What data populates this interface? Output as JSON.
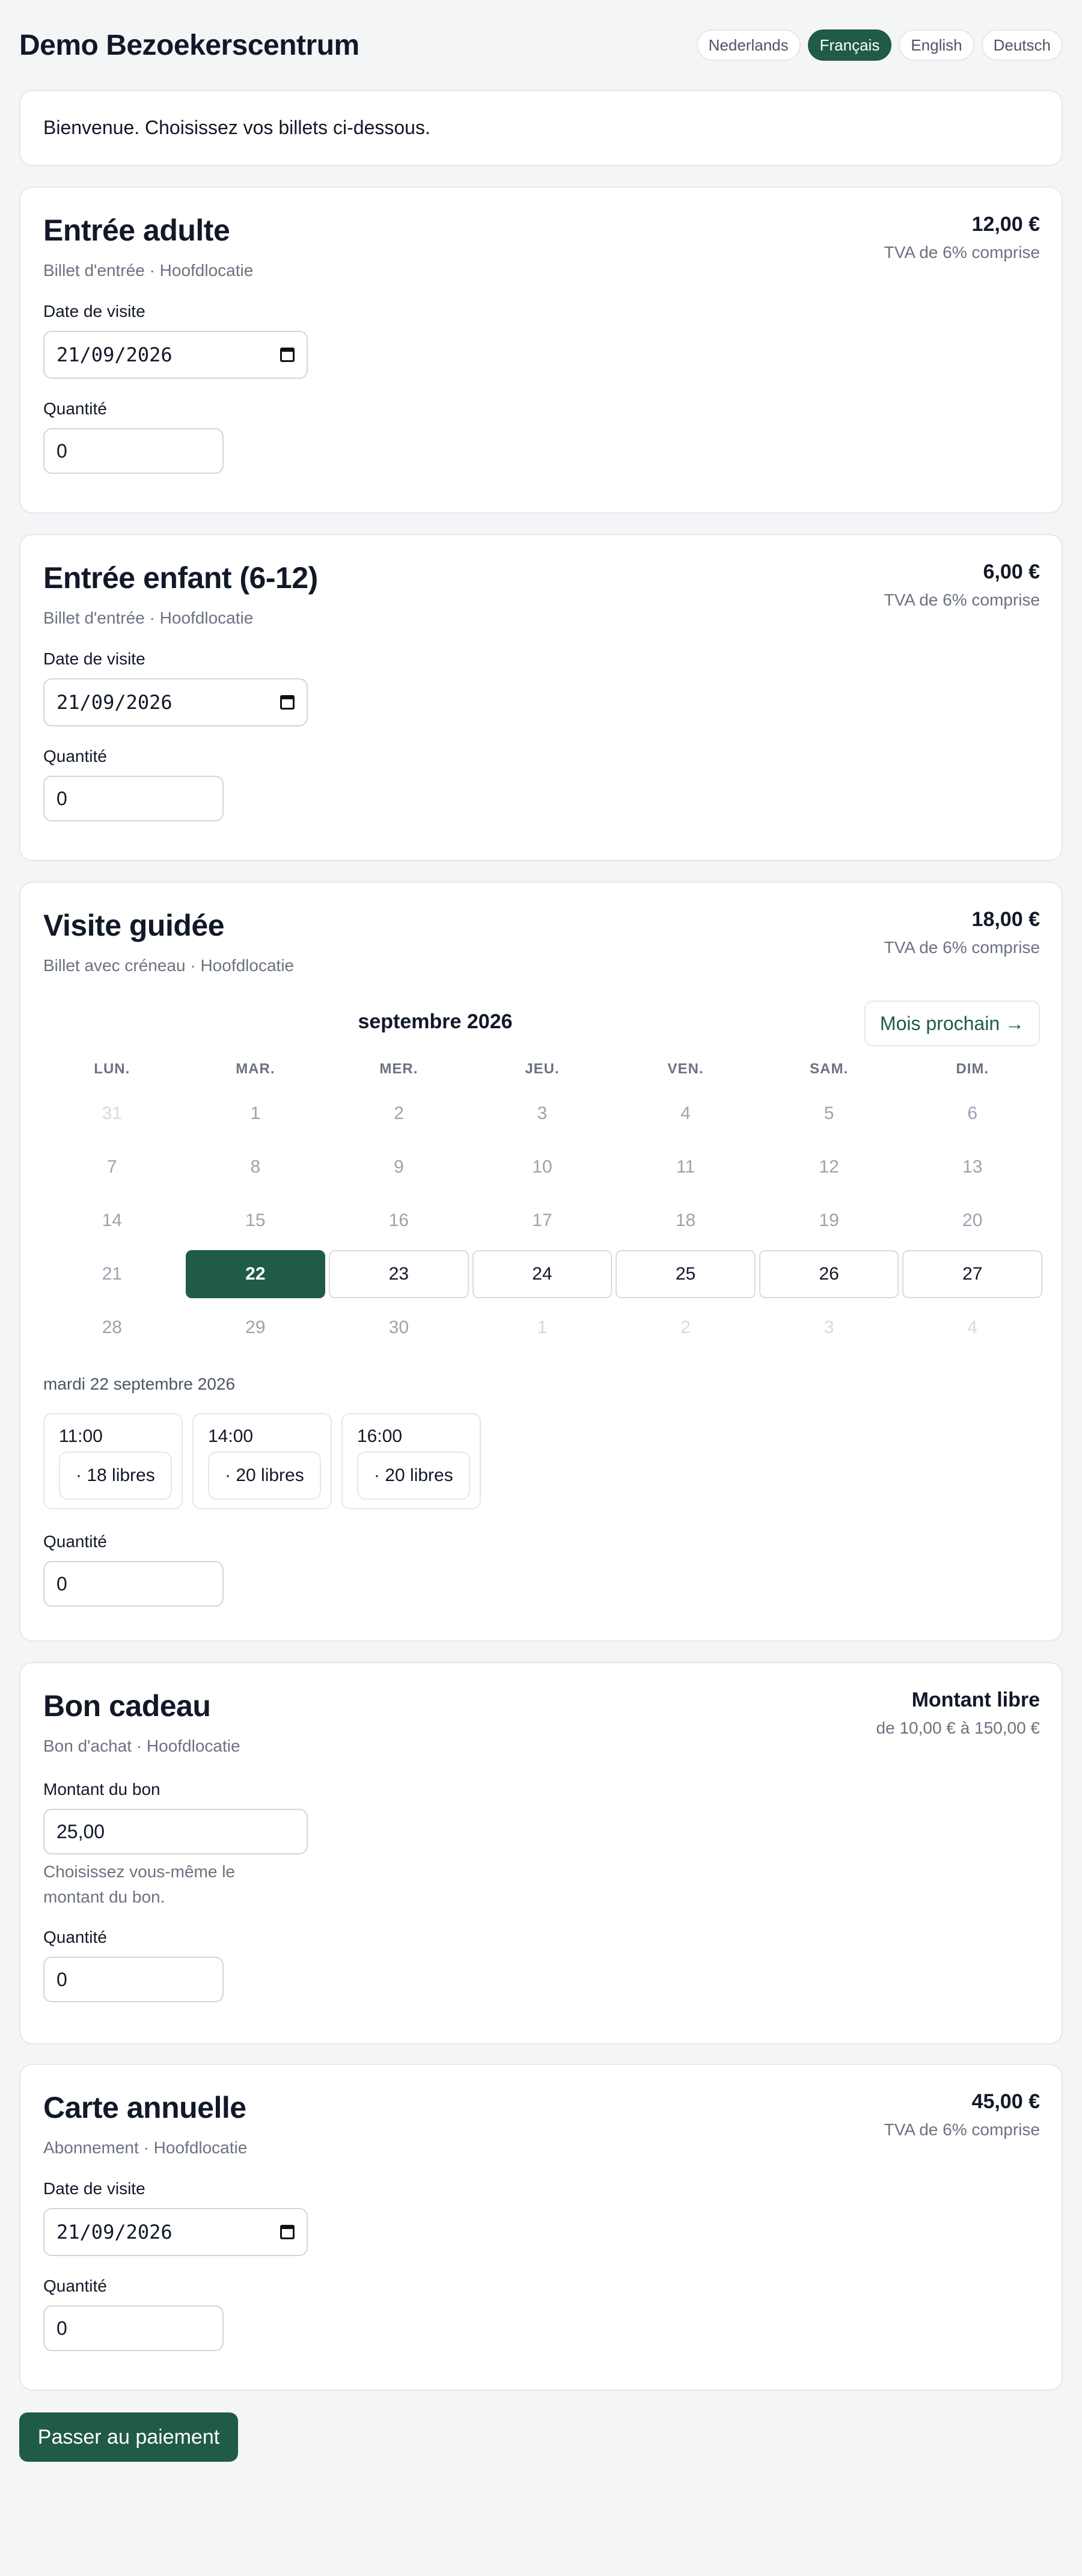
{
  "site": {
    "title": "Demo Bezoekerscentrum"
  },
  "languages": [
    {
      "label": "Nederlands",
      "active": false
    },
    {
      "label": "Français",
      "active": true
    },
    {
      "label": "English",
      "active": false
    },
    {
      "label": "Deutsch",
      "active": false
    }
  ],
  "welcome": "Bienvenue. Choisissez vos billets ci-dessous.",
  "labels": {
    "visit_date": "Date de visite",
    "quantity": "Quantité",
    "voucher_amount": "Montant du bon",
    "voucher_help": "Choisissez vous-même le montant du bon."
  },
  "products": {
    "adult": {
      "title": "Entrée adulte",
      "subtitle": "Billet d'entrée · Hoofdlocatie",
      "price": "12,00 €",
      "vat": "TVA de 6% comprise",
      "date": "21/09/2026",
      "quantity": "0"
    },
    "child": {
      "title": "Entrée enfant (6-12)",
      "subtitle": "Billet d'entrée · Hoofdlocatie",
      "price": "6,00 €",
      "vat": "TVA de 6% comprise",
      "date": "21/09/2026",
      "quantity": "0"
    },
    "guided": {
      "title": "Visite guidée",
      "subtitle": "Billet avec créneau · Hoofdlocatie",
      "price": "18,00 €",
      "vat": "TVA de 6% comprise",
      "calendar": {
        "month": "septembre 2026",
        "next_button": "Mois prochain →",
        "weekdays": [
          "LUN.",
          "MAR.",
          "MER.",
          "JEU.",
          "VEN.",
          "SAM.",
          "DIM."
        ],
        "weeks": [
          [
            {
              "d": "31",
              "s": "out"
            },
            {
              "d": "1",
              "s": "past"
            },
            {
              "d": "2",
              "s": "past"
            },
            {
              "d": "3",
              "s": "past"
            },
            {
              "d": "4",
              "s": "past"
            },
            {
              "d": "5",
              "s": "past"
            },
            {
              "d": "6",
              "s": "past"
            }
          ],
          [
            {
              "d": "7",
              "s": "past"
            },
            {
              "d": "8",
              "s": "past"
            },
            {
              "d": "9",
              "s": "past"
            },
            {
              "d": "10",
              "s": "past"
            },
            {
              "d": "11",
              "s": "past"
            },
            {
              "d": "12",
              "s": "past"
            },
            {
              "d": "13",
              "s": "past"
            }
          ],
          [
            {
              "d": "14",
              "s": "past"
            },
            {
              "d": "15",
              "s": "past"
            },
            {
              "d": "16",
              "s": "past"
            },
            {
              "d": "17",
              "s": "past"
            },
            {
              "d": "18",
              "s": "past"
            },
            {
              "d": "19",
              "s": "past"
            },
            {
              "d": "20",
              "s": "past"
            }
          ],
          [
            {
              "d": "21",
              "s": "past"
            },
            {
              "d": "22",
              "s": "selected"
            },
            {
              "d": "23",
              "s": "avail"
            },
            {
              "d": "24",
              "s": "avail"
            },
            {
              "d": "25",
              "s": "avail"
            },
            {
              "d": "26",
              "s": "avail"
            },
            {
              "d": "27",
              "s": "avail"
            }
          ],
          [
            {
              "d": "28",
              "s": "past"
            },
            {
              "d": "29",
              "s": "past"
            },
            {
              "d": "30",
              "s": "past"
            },
            {
              "d": "1",
              "s": "out"
            },
            {
              "d": "2",
              "s": "out"
            },
            {
              "d": "3",
              "s": "out"
            },
            {
              "d": "4",
              "s": "out"
            }
          ]
        ]
      },
      "selected_date": "mardi 22 septembre 2026",
      "slots": [
        {
          "time": "11:00",
          "free": "· 18 libres"
        },
        {
          "time": "14:00",
          "free": "· 20 libres"
        },
        {
          "time": "16:00",
          "free": "· 20 libres"
        }
      ],
      "quantity": "0"
    },
    "voucher": {
      "title": "Bon cadeau",
      "subtitle": "Bon d'achat · Hoofdlocatie",
      "price": "Montant libre",
      "range": "de 10,00 € à 150,00 €",
      "amount": "25,00",
      "quantity": "0"
    },
    "annual": {
      "title": "Carte annuelle",
      "subtitle": "Abonnement · Hoofdlocatie",
      "price": "45,00 €",
      "vat": "TVA de 6% comprise",
      "date": "21/09/2026",
      "quantity": "0"
    }
  },
  "checkout_button": "Passer au paiement",
  "colors": {
    "accent": "#1f5b45",
    "muted": "#6b7280",
    "border": "#e5e7eb"
  }
}
